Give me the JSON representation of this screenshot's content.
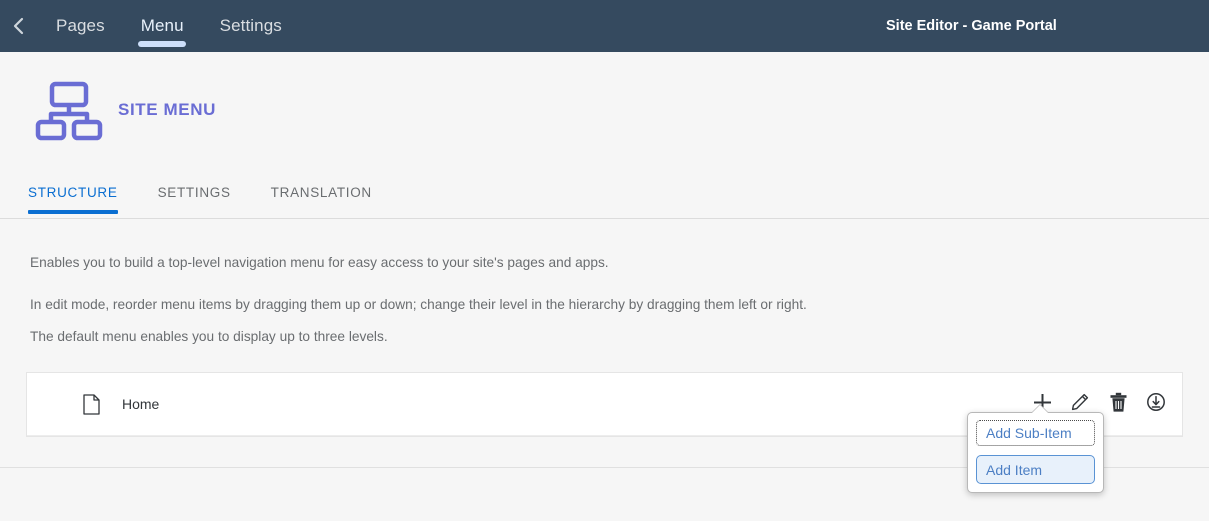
{
  "topbar": {
    "back_icon": "chevron-left-icon",
    "nav": [
      {
        "label": "Pages",
        "active": false
      },
      {
        "label": "Menu",
        "active": true
      },
      {
        "label": "Settings",
        "active": false
      }
    ],
    "title": "Site Editor - Game Portal",
    "background_color": "#354a5f",
    "active_indicator_color": "#cddffa"
  },
  "page_header": {
    "icon": "sitemap-icon",
    "title": "SITE MENU",
    "title_color": "#6a6dd4"
  },
  "tabs": [
    {
      "label": "STRUCTURE",
      "active": true
    },
    {
      "label": "SETTINGS",
      "active": false
    },
    {
      "label": "TRANSLATION",
      "active": false
    }
  ],
  "tab_active_color": "#0a6ed1",
  "description": {
    "line1": "Enables you to build a top-level navigation menu for easy access to your site's pages and apps.",
    "line2": "In edit mode, reorder menu items by dragging them up or down; change their level in the hierarchy by dragging them left or right.",
    "line3": "The default menu enables you to display up to three levels."
  },
  "menu_items": [
    {
      "icon": "page-document-icon",
      "label": "Home",
      "actions": [
        {
          "name": "add-icon",
          "tooltip": "Add"
        },
        {
          "name": "edit-pencil-icon",
          "tooltip": "Edit"
        },
        {
          "name": "delete-trash-icon",
          "tooltip": "Delete"
        },
        {
          "name": "circle-arrow-down-icon",
          "tooltip": "Move"
        }
      ]
    }
  ],
  "popover": {
    "items": [
      {
        "label": "Add Sub-Item",
        "state": "focused"
      },
      {
        "label": "Add Item",
        "state": "selected"
      }
    ],
    "link_color": "#4c7fc4",
    "selected_bg": "#e8f1fb",
    "selected_border": "#5a93d4"
  }
}
